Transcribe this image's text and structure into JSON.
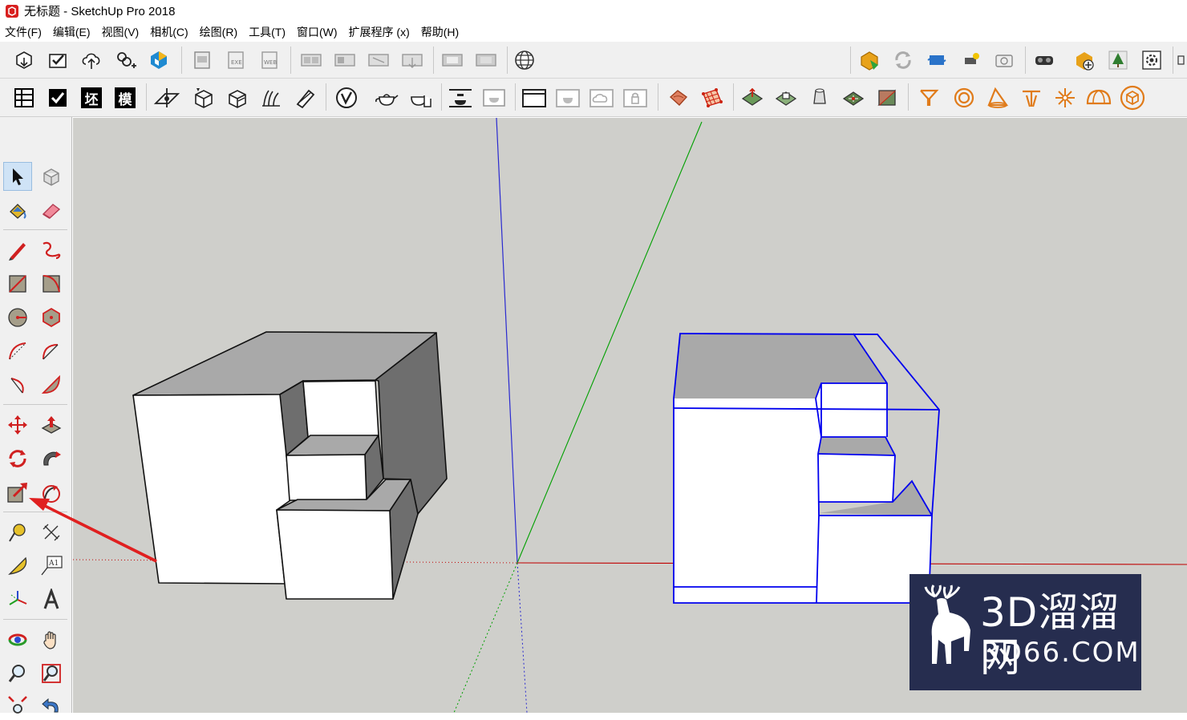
{
  "window": {
    "title": "无标题 - SketchUp Pro 2018"
  },
  "menu": [
    "文件(F)",
    "编辑(E)",
    "视图(V)",
    "相机(C)",
    "绘图(R)",
    "工具(T)",
    "窗口(W)",
    "扩展程序 (x)",
    "帮助(H)"
  ],
  "toolbar2_text_buttons": [
    "坯",
    "模"
  ],
  "watermark": {
    "line1": "3D溜溜网",
    "line2": "3D66.COM"
  },
  "colors": {
    "selection": "#0000ee",
    "axis_red": "#d00000",
    "axis_green": "#00a000",
    "axis_blue": "#0000cc",
    "annotation_arrow": "#e02020",
    "viewport_bg": "#cfcfcb"
  }
}
